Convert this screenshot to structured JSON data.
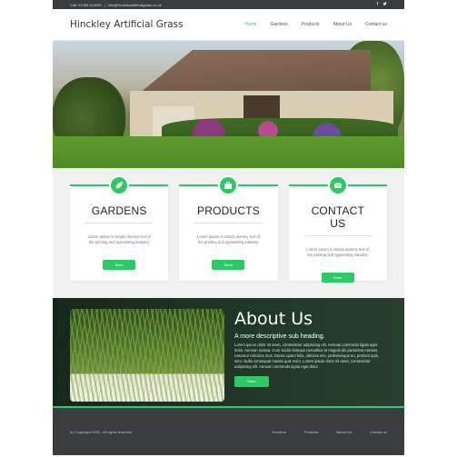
{
  "topbar": {
    "phone": "Call: 01455 610990",
    "separator": "|",
    "email": "info@hinckleyartificialgrass.co.uk",
    "social_icons": [
      "facebook-icon",
      "twitter-icon"
    ]
  },
  "header": {
    "logo": "Hinckley Artificial Grass",
    "nav": [
      {
        "label": "Home",
        "active": true
      },
      {
        "label": "Gardens",
        "active": false
      },
      {
        "label": "Products",
        "active": false
      },
      {
        "label": "About Us",
        "active": false
      },
      {
        "label": "Contact us",
        "active": false
      }
    ]
  },
  "features": [
    {
      "icon": "leaf-icon",
      "title": "GARDENS",
      "text": "Lorem Ipsum is simply dummy text of the printing and typesetting industry.",
      "button": "More"
    },
    {
      "icon": "briefcase-icon",
      "title": "PRODUCTS",
      "text": "Lorem Ipsum is simply dummy text of the printing and typesetting industry.",
      "button": "More"
    },
    {
      "icon": "envelope-icon",
      "title": "CONTACT US",
      "text": "Lorem Ipsum is simply dummy text of the printing and typesetting industry.",
      "button": "More"
    }
  ],
  "about": {
    "title": "About Us",
    "subtitle": "A more descriptive sub heading.",
    "body": "Lorem ipsum dolor sit amet, consectetur adipiscing elit. Aenean commodo ligula eget dolor. Aenean massa. Cum sociis natoque penatibus et magnis dis parturient montes, nascetur ridiculus mus. Donec quam felis, ultricies nec, pellentesque eu, pretium quis, sem. Nulla consequat massa quis enim. Lorem ipsum dolor sit amet, consectetur adipiscing elit. Aenean commodo ligula eget dolor.",
    "button": "More"
  },
  "footer": {
    "copyright": "(c) Copyright 2015 - All rights reserved",
    "links": [
      "Gardens",
      "Products",
      "About Us",
      "Contact us"
    ]
  },
  "colors": {
    "accent": "#2ec866",
    "topbar_bg": "#3a3d40",
    "about_bg": "#1c3122",
    "footer_bg": "#3a3d40"
  }
}
